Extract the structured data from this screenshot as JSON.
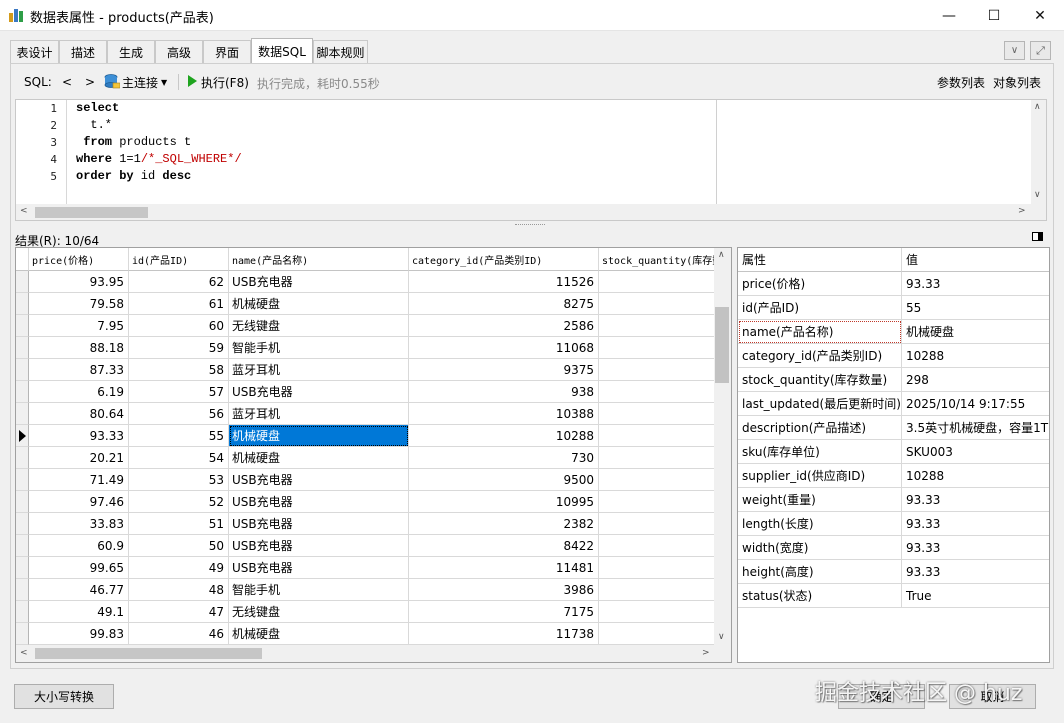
{
  "window": {
    "title": "数据表属性 - products(产品表)",
    "controls": {
      "minimize": "—",
      "maximize": "☐",
      "close": "✕"
    }
  },
  "tabs": [
    "表设计",
    "描述",
    "生成",
    "高级",
    "界面",
    "数据SQL",
    "脚本规则"
  ],
  "active_tab": "数据SQL",
  "toolbar": {
    "sql_label": "SQL:",
    "prev": "<",
    "next": ">",
    "connection": "主连接",
    "run": "执行(F8)",
    "status": "执行完成，耗时0.55秒",
    "params_list": "参数列表",
    "objects_list": "对象列表"
  },
  "editor": {
    "line_numbers": [
      "1",
      "2",
      "3",
      "4",
      "5"
    ],
    "lines": [
      [
        {
          "t": "select",
          "c": "kw"
        }
      ],
      [
        {
          "t": "  t.*",
          "c": ""
        }
      ],
      [
        {
          "t": " from",
          "c": "kw"
        },
        {
          "t": " products t",
          "c": ""
        }
      ],
      [
        {
          "t": "where",
          "c": "kw"
        },
        {
          "t": " 1=1",
          "c": ""
        },
        {
          "t": "/*_SQL_WHERE*/",
          "c": "cm"
        }
      ],
      [
        {
          "t": "order by",
          "c": "kw"
        },
        {
          "t": " id ",
          "c": ""
        },
        {
          "t": "desc",
          "c": "kw"
        }
      ]
    ]
  },
  "results": {
    "label": "结果(R): 10/64",
    "columns": [
      "price(价格)",
      "id(产品ID)",
      "name(产品名称)",
      "category_id(产品类别ID)",
      "stock_quantity(库存数量)"
    ],
    "rows": [
      [
        "93.95",
        "62",
        "USB充电器",
        "11526",
        ""
      ],
      [
        "79.58",
        "61",
        "机械硬盘",
        "8275",
        ""
      ],
      [
        "7.95",
        "60",
        "无线键盘",
        "2586",
        ""
      ],
      [
        "88.18",
        "59",
        "智能手机",
        "11068",
        ""
      ],
      [
        "87.33",
        "58",
        "蓝牙耳机",
        "9375",
        ""
      ],
      [
        "6.19",
        "57",
        "USB充电器",
        "938",
        ""
      ],
      [
        "80.64",
        "56",
        "蓝牙耳机",
        "10388",
        ""
      ],
      [
        "93.33",
        "55",
        "机械硬盘",
        "10288",
        ""
      ],
      [
        "20.21",
        "54",
        "机械硬盘",
        "730",
        ""
      ],
      [
        "71.49",
        "53",
        "USB充电器",
        "9500",
        ""
      ],
      [
        "97.46",
        "52",
        "USB充电器",
        "10995",
        ""
      ],
      [
        "33.83",
        "51",
        "USB充电器",
        "2382",
        ""
      ],
      [
        "60.9",
        "50",
        "USB充电器",
        "8422",
        ""
      ],
      [
        "99.65",
        "49",
        "USB充电器",
        "11481",
        ""
      ],
      [
        "46.77",
        "48",
        "智能手机",
        "3986",
        ""
      ],
      [
        "49.1",
        "47",
        "无线键盘",
        "7175",
        ""
      ],
      [
        "99.83",
        "46",
        "机械硬盘",
        "11738",
        ""
      ]
    ],
    "current_row_index": 7,
    "selected_column_index": 2
  },
  "properties": {
    "header_name": "属性",
    "header_value": "值",
    "items": [
      {
        "name": "price(价格)",
        "value": "93.33"
      },
      {
        "name": "id(产品ID)",
        "value": "55"
      },
      {
        "name": "name(产品名称)",
        "value": "机械硬盘"
      },
      {
        "name": "category_id(产品类别ID)",
        "value": "10288"
      },
      {
        "name": "stock_quantity(库存数量)",
        "value": "298"
      },
      {
        "name": "last_updated(最后更新时间)",
        "value": "2025/10/14 9:17:55"
      },
      {
        "name": "description(产品描述)",
        "value": "3.5英寸机械硬盘，容量1T"
      },
      {
        "name": "sku(库存单位)",
        "value": "SKU003"
      },
      {
        "name": "supplier_id(供应商ID)",
        "value": "10288"
      },
      {
        "name": "weight(重量)",
        "value": "93.33"
      },
      {
        "name": "length(长度)",
        "value": "93.33"
      },
      {
        "name": "width(宽度)",
        "value": "93.33"
      },
      {
        "name": "height(高度)",
        "value": "93.33"
      },
      {
        "name": "status(状态)",
        "value": "True"
      }
    ],
    "focused_index": 2
  },
  "footer": {
    "case_button": "大小写转换",
    "ok": "确定",
    "cancel": "取消",
    "watermark": "掘金技术社区 @ huz"
  },
  "colors": {
    "selection": "#0078d7",
    "run_icon": "#1fa41f",
    "sql_comment": "#c00000"
  }
}
